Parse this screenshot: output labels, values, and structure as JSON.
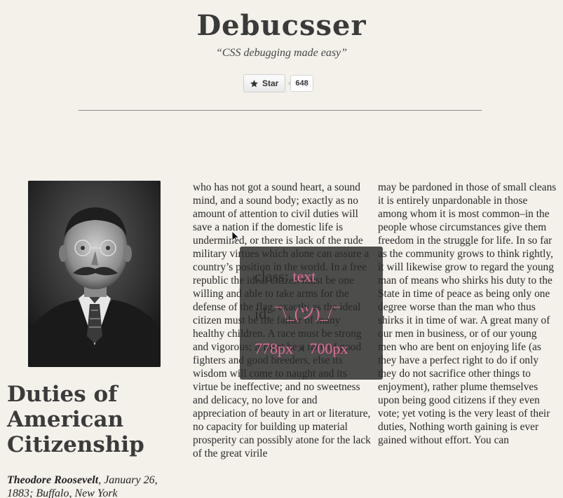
{
  "header": {
    "title": "Debucsser",
    "tagline": "“CSS debugging made easy”",
    "star_label": "Star",
    "star_count": "648"
  },
  "article": {
    "title": "Duties of American Citizenship",
    "author": "Theodore Roosevelt",
    "byline_rest": ", January 26, 1883; Buffalo, New York",
    "column1": "who has not got a sound heart, a sound mind, and a sound body; exactly as no amount of attention to civil duties will save a nation if the domestic life is undermined, or there is lack of the rude military virtues which alone can assure a country’s position in the world. In a free republic the ideal citizen must be one willing and able to take arms for the defense of the flag, exactly as the ideal citizen must be the father of many healthy children. A race must be strong and vigorous; it must be a race of good fighters and good breeders, else its wisdom will come to naught and its virtue be ineffective; and no sweetness and delicacy, no love for and appreciation of beauty in art or literature, no capacity for building up material prosperity can possibly atone for the lack of the great virile",
    "column2": "may be pardoned in those of small cleans it is entirely unpardonable in those among whom it is most common–in the people whose circumstances give them freedom in the struggle for life. In so far as the community grows to think rightly, it will likewise grow to regard the young man of means who shirks his duty to the State in time of peace as being only one degree worse than the man who thus shirks it in time of war. A great many of our men in business, or of our young men who are bent on enjoying life (as they have a perfect right to do if only they do not sacrifice other things to enjoyment), rather plume themselves upon being good citizens if they even vote; yet voting is the very least of their duties, Nothing worth gaining is ever gained without effort. You can"
  },
  "debug_overlay": {
    "class_label": "class:",
    "class_value": "text",
    "id_label": "id:",
    "id_value": "¯\\_(ツ)_/¯",
    "width_value": "778px",
    "times": "×",
    "height_value": "700px"
  },
  "colors": {
    "background": "#f4f1ea",
    "overlay_bg": "#282828",
    "overlay_accent": "#e36d9a"
  }
}
